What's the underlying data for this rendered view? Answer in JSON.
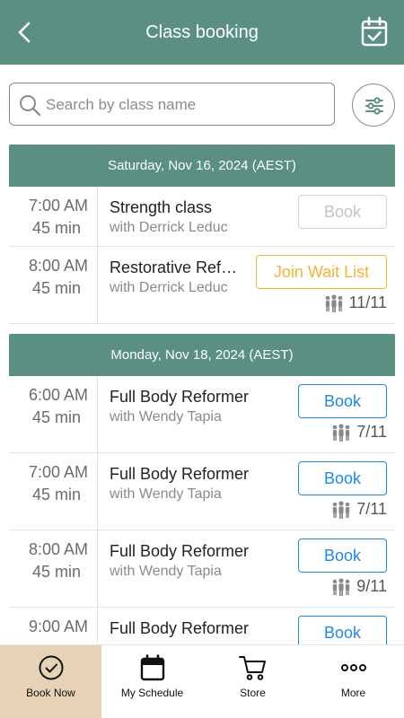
{
  "header": {
    "title": "Class booking",
    "back_icon": "chevron-left-icon",
    "calendar_icon": "calendar-check-icon"
  },
  "search": {
    "placeholder": "Search by class name",
    "value": ""
  },
  "colors": {
    "brand": "#5b8f82",
    "book": "#1e88e5",
    "waitlist": "#f2b531",
    "active_tab": "#e6d3b5"
  },
  "days": [
    {
      "label": "Saturday, Nov 16, 2024 (AEST)",
      "classes": [
        {
          "time": "7:00  AM",
          "duration": "45 min",
          "name": "Strength class",
          "teacher": "with Derrick Leduc",
          "action": "Book",
          "state": "disabled",
          "capacity": ""
        },
        {
          "time": "8:00  AM",
          "duration": "45 min",
          "name": "Restorative Reformer",
          "teacher": "with Derrick Leduc",
          "action": "Join Wait List",
          "state": "waitlist",
          "capacity": "11/11"
        }
      ]
    },
    {
      "label": "Monday, Nov 18, 2024 (AEST)",
      "classes": [
        {
          "time": "6:00  AM",
          "duration": "45 min",
          "name": "Full Body Reformer",
          "teacher": "with Wendy Tapia",
          "action": "Book",
          "state": "available",
          "capacity": "7/11"
        },
        {
          "time": "7:00  AM",
          "duration": "45 min",
          "name": "Full Body Reformer",
          "teacher": "with Wendy Tapia",
          "action": "Book",
          "state": "available",
          "capacity": "7/11"
        },
        {
          "time": "8:00  AM",
          "duration": "45 min",
          "name": "Full Body Reformer",
          "teacher": "with Wendy Tapia",
          "action": "Book",
          "state": "available",
          "capacity": "9/11"
        },
        {
          "time": "9:00  AM",
          "duration": "",
          "name": "Full Body Reformer",
          "teacher": "",
          "action": "Book",
          "state": "available",
          "capacity": ""
        }
      ]
    }
  ],
  "tabs": [
    {
      "label": "Book Now",
      "icon": "check-circle-icon",
      "active": true
    },
    {
      "label": "My Schedule",
      "icon": "calendar-icon",
      "active": false
    },
    {
      "label": "Store",
      "icon": "cart-icon",
      "active": false
    },
    {
      "label": "More",
      "icon": "more-dots-icon",
      "active": false
    }
  ]
}
